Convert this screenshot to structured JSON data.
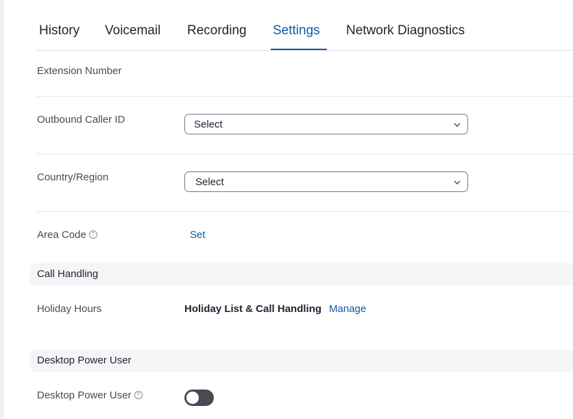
{
  "tabs": [
    {
      "label": "History",
      "active": false
    },
    {
      "label": "Voicemail",
      "active": false
    },
    {
      "label": "Recording",
      "active": false
    },
    {
      "label": "Settings",
      "active": true
    },
    {
      "label": "Network Diagnostics",
      "active": false
    }
  ],
  "settings": {
    "extension_number": {
      "label": "Extension Number"
    },
    "outbound_caller_id": {
      "label": "Outbound Caller ID",
      "value": "Select"
    },
    "country_region": {
      "label": "Country/Region",
      "value": "Select"
    },
    "area_code": {
      "label": "Area Code",
      "action": "Set",
      "help": "?"
    }
  },
  "call_handling": {
    "title": "Call Handling",
    "holiday_hours": {
      "label": "Holiday Hours",
      "value": "Holiday List & Call Handling",
      "action": "Manage"
    }
  },
  "desktop_power_user": {
    "title": "Desktop Power User",
    "row": {
      "label": "Desktop Power User",
      "help": "?",
      "enabled": false
    }
  },
  "colors": {
    "accent": "#0e5aa7",
    "toggle_off": "#4a4a55",
    "section_bg": "#f5f5f7"
  }
}
